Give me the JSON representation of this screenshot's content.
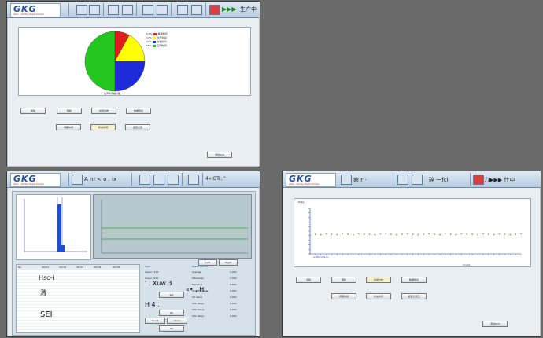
{
  "logo": {
    "brand": "GKG",
    "tagline": "GKG · Solder Paste Printer"
  },
  "win1": {
    "status": "生产中",
    "legend": [
      {
        "label": "等待时间",
        "color": "#e21b1b"
      },
      {
        "label": "生产时间",
        "color": "#ffff00"
      },
      {
        "label": "停机时间",
        "color": "#1d2bd8"
      },
      {
        "label": "空闲时间",
        "color": "#22c81e"
      }
    ],
    "legend_values": [
      "0.5%",
      "17%",
      "27%",
      "55%"
    ],
    "pie_caption": "生产时间统计图",
    "buttons_row1": [
      "清除",
      "刷新",
      "时间分布",
      "数据导出"
    ],
    "buttons_row2": [
      "周期时间",
      "状态时间",
      "报警记录"
    ],
    "exit": "退出Exit"
  },
  "win2": {
    "title_a": "A m < o . ix",
    "title_b": "4« OTr, \"",
    "table_headers": [
      "No.",
      "Val 01",
      "Val 02",
      "Val 03",
      "Val 04",
      "Val 05"
    ],
    "col_texts": [
      "Hsc-i",
      "溅",
      "SEI"
    ],
    "spec_title": "Spec",
    "spec_upper": "Upper Limit",
    "spec_lower": "Lower Limit",
    "spec_mid": "' . Xuw 3",
    "h_a": "H 4 .",
    "h_b": "«• ,  H .",
    "mid_buttons": [
      "Set",
      "Ok"
    ],
    "lower_buttons": [
      "Reset",
      "About"
    ],
    "exit_small": "OK",
    "toolbar_btns": [
      "Left",
      "Right"
    ],
    "result_title": "Result Pad ID",
    "result_rows": [
      [
        "Average",
        "1.000"
      ],
      [
        "MaxValue",
        "1.500"
      ],
      [
        "MinValue",
        "0.800"
      ],
      [
        "StdDEV Value",
        "0.052"
      ],
      [
        "CP Value",
        "0.000"
      ],
      [
        "CPk Value",
        "0.000"
      ],
      [
        "CPU Value",
        "0.000"
      ],
      [
        "CPL Value",
        "0.000"
      ]
    ]
  },
  "win3": {
    "title_a": "命 r ·",
    "title_b": "碎 一fci",
    "title_c": "力▶▶▶ 什中",
    "chart_title": "Data",
    "xlabel_left": "a«fit«r«Ea.it»",
    "xlabel_right": "Count",
    "buttons_row1": [
      "清除",
      "刷新",
      "时间分布",
      "数据导出"
    ],
    "buttons_row2": [
      "周期时间",
      "状态时间",
      "报警记录口"
    ],
    "exit": "退出Exit"
  },
  "chart_data": [
    {
      "type": "pie",
      "title": "",
      "categories": [
        "等待时间",
        "生产时间",
        "停机时间",
        "空闲时间"
      ],
      "values": [
        8,
        17,
        25,
        50
      ],
      "colors": [
        "#e21b1b",
        "#ffff00",
        "#1d2bd8",
        "#22c81e"
      ]
    },
    {
      "type": "line",
      "title": "Data",
      "x": [
        1,
        2,
        3,
        4,
        5,
        6,
        7,
        8,
        9,
        10,
        11,
        12,
        13,
        14,
        15,
        16,
        17,
        18,
        19,
        20,
        21,
        22,
        23,
        24,
        25,
        26,
        27,
        28,
        29,
        30,
        31,
        32,
        33,
        34,
        35,
        36,
        37,
        38,
        39,
        40
      ],
      "series": [
        {
          "values": [
            4.2,
            4.3,
            4.2,
            4.4,
            4.3,
            4.2,
            4.5,
            4.3,
            4.2,
            4.4,
            4.3,
            4.3,
            4.2,
            4.4,
            4.5,
            4.3,
            4.2,
            4.3,
            4.4,
            4.3,
            4.2,
            4.3,
            4.4,
            4.3,
            4.2,
            4.5,
            4.3,
            4.2,
            4.4,
            4.3,
            4.3,
            4.2,
            4.4,
            4.3,
            4.2,
            4.4,
            4.3,
            4.2,
            4.3,
            4.4
          ]
        }
      ],
      "ylim": [
        0,
        10
      ]
    }
  ]
}
